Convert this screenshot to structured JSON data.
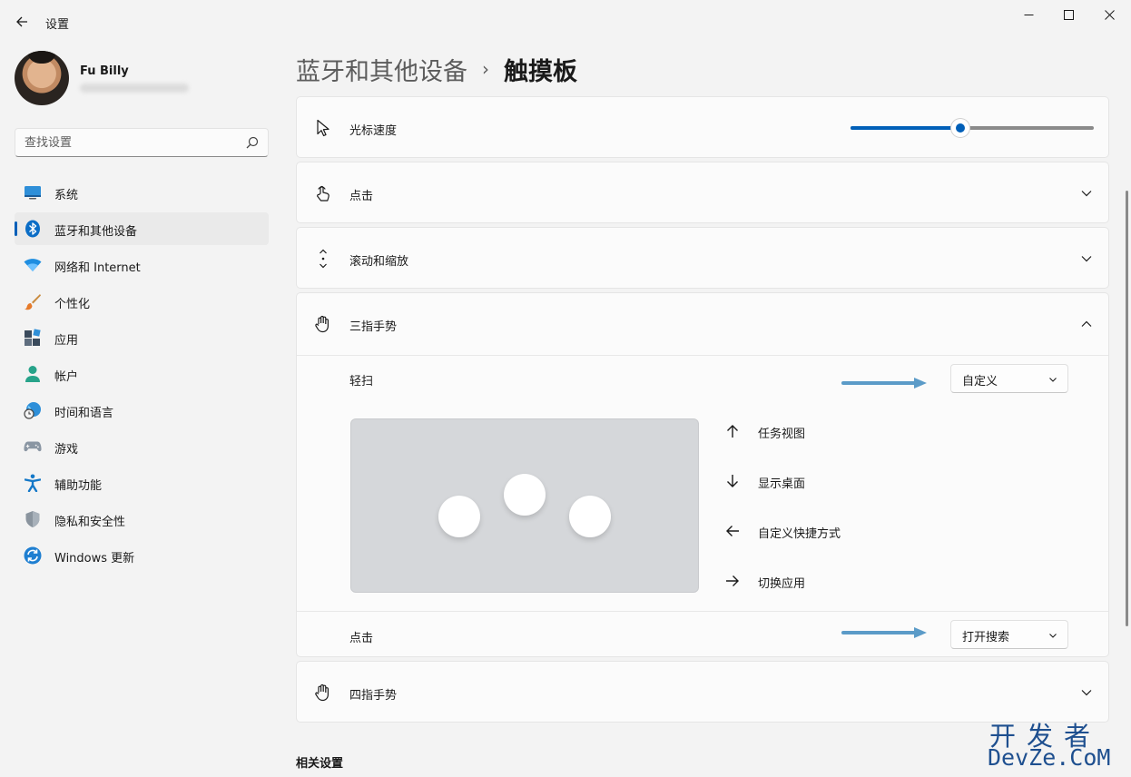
{
  "window": {
    "title": "设置"
  },
  "user": {
    "name": "Fu Billy"
  },
  "search": {
    "placeholder": "查找设置"
  },
  "sidebar": {
    "items": [
      {
        "label": "系统",
        "icon": "monitor-icon"
      },
      {
        "label": "蓝牙和其他设备",
        "icon": "bluetooth-icon",
        "active": true
      },
      {
        "label": "网络和 Internet",
        "icon": "wifi-icon"
      },
      {
        "label": "个性化",
        "icon": "brush-icon"
      },
      {
        "label": "应用",
        "icon": "apps-icon"
      },
      {
        "label": "帐户",
        "icon": "person-icon"
      },
      {
        "label": "时间和语言",
        "icon": "globe-clock-icon"
      },
      {
        "label": "游戏",
        "icon": "gamepad-icon"
      },
      {
        "label": "辅助功能",
        "icon": "accessibility-icon"
      },
      {
        "label": "隐私和安全性",
        "icon": "shield-icon"
      },
      {
        "label": "Windows 更新",
        "icon": "update-icon"
      }
    ]
  },
  "breadcrumb": {
    "parent": "蓝牙和其他设备",
    "separator": "›",
    "current": "触摸板"
  },
  "settings": {
    "cursor_speed": {
      "label": "光标速度",
      "value_fraction": 0.45
    },
    "tap": {
      "label": "点击"
    },
    "scroll_zoom": {
      "label": "滚动和缩放"
    },
    "three_finger": {
      "label": "三指手势",
      "swipe_label": "轻扫",
      "swipe_value": "自定义",
      "gestures": [
        {
          "direction": "up",
          "label": "任务视图"
        },
        {
          "direction": "down",
          "label": "显示桌面"
        },
        {
          "direction": "left",
          "label": "自定义快捷方式"
        },
        {
          "direction": "right",
          "label": "切换应用"
        }
      ],
      "tap_label": "点击",
      "tap_value": "打开搜索"
    },
    "four_finger": {
      "label": "四指手势"
    }
  },
  "related": {
    "title": "相关设置"
  },
  "watermark": {
    "line1": "开发者",
    "line2": "DevZe.CoM"
  },
  "colors": {
    "accent": "#005fb8",
    "annotation_arrow": "#5b9bc8",
    "watermark": "#1e4f8f"
  }
}
